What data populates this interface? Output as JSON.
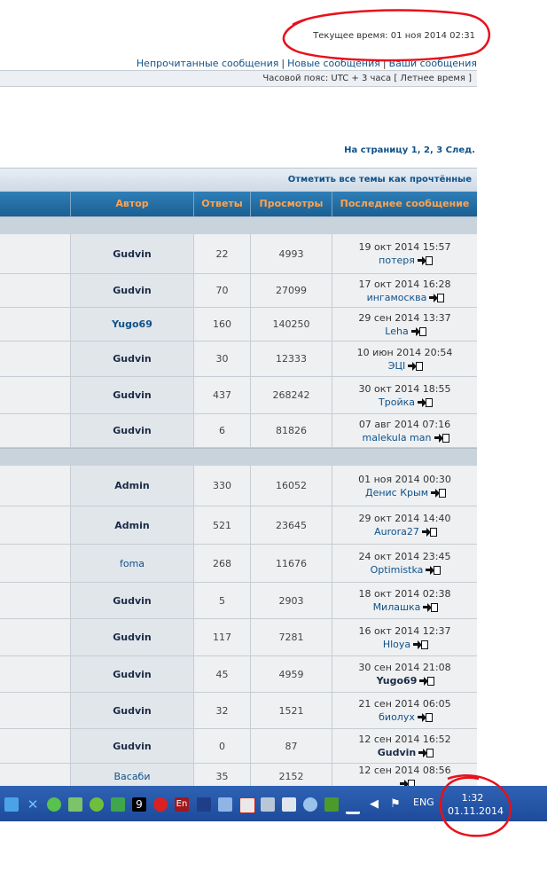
{
  "header": {
    "current_time": "Текущее время: 01 ноя 2014 02:31",
    "links": [
      "Непрочитанные сообщения",
      "Новые сообщения",
      "Ваши сообщения"
    ],
    "separator": "|",
    "timezone": "Часовой пояс: UTC + 3 часа [ Летнее время ]"
  },
  "pagination": {
    "label": "На страницу",
    "pages": [
      "1",
      "2",
      "3"
    ],
    "next": "След."
  },
  "forum": {
    "mark_all_read": "Отметить все темы как прочтённые",
    "columns": [
      "Автор",
      "Ответы",
      "Просмотры",
      "Последнее сообщение"
    ],
    "rows_group1": [
      {
        "author": "Gudvin",
        "replies": "22",
        "views": "4993",
        "last_date": "19 окт 2014 15:57",
        "last_user": "потеря"
      },
      {
        "author": "Gudvin",
        "replies": "70",
        "views": "27099",
        "last_date": "17 окт 2014 16:28",
        "last_user": "ингамосква"
      },
      {
        "author": "Yugo69",
        "replies": "160",
        "views": "140250",
        "last_date": "29 сен 2014 13:37",
        "last_user": "Leha"
      },
      {
        "author": "Gudvin",
        "replies": "30",
        "views": "12333",
        "last_date": "10 июн 2014 20:54",
        "last_user": "ЭЦI"
      },
      {
        "author": "Gudvin",
        "replies": "437",
        "views": "268242",
        "last_date": "30 окт 2014 18:55",
        "last_user": "Тройка"
      },
      {
        "author": "Gudvin",
        "replies": "6",
        "views": "81826",
        "last_date": "07 авг 2014 07:16",
        "last_user": "malekula man"
      }
    ],
    "rows_group2": [
      {
        "author": "Admin",
        "replies": "330",
        "views": "16052",
        "last_date": "01 ноя 2014 00:30",
        "last_user": "Денис Крым"
      },
      {
        "author": "Admin",
        "replies": "521",
        "views": "23645",
        "last_date": "29 окт 2014 14:40",
        "last_user": "Aurora27"
      },
      {
        "author": "foma",
        "replies": "268",
        "views": "11676",
        "last_date": "24 окт 2014 23:45",
        "last_user": "Optimistka"
      },
      {
        "author": "Gudvin",
        "replies": "5",
        "views": "2903",
        "last_date": "18 окт 2014 02:38",
        "last_user": "Милашка"
      },
      {
        "author": "Gudvin",
        "replies": "117",
        "views": "7281",
        "last_date": "16 окт 2014 12:37",
        "last_user": "Hloya"
      },
      {
        "author": "Gudvin",
        "replies": "45",
        "views": "4959",
        "last_date": "30 сен 2014 21:08",
        "last_user": "Yugo69"
      },
      {
        "author": "Gudvin",
        "replies": "32",
        "views": "1521",
        "last_date": "21 сен 2014 06:05",
        "last_user": "биолух"
      },
      {
        "author": "Gudvin",
        "replies": "0",
        "views": "87",
        "last_date": "12 сен 2014 16:52",
        "last_user": "Gudvin"
      },
      {
        "author": "Васаби",
        "replies": "35",
        "views": "2152",
        "last_date": "12 сен 2014 08:56",
        "last_user": ""
      }
    ]
  },
  "taskbar": {
    "language": "ENG",
    "clock_time": "1:32",
    "clock_date": "01.11.2014",
    "tray_nine": "9",
    "tray_en": "En",
    "icons": [
      "bluetooth-icon",
      "x-app-icon",
      "shield-icon",
      "recycle-icon",
      "utorrent-icon",
      "nine-icon",
      "clock-icon",
      "language-en-icon",
      "bluetooth-tray-icon",
      "display-icon",
      "media-icon",
      "device-icon",
      "usb-icon",
      "network-icon",
      "nvidia-icon",
      "signal-icon",
      "volume-icon",
      "flag-icon"
    ]
  },
  "colors": {
    "link": "#105289",
    "column_header_text": "#ffa34f",
    "column_header_bg": "#1a5f93",
    "taskbar": "#1d4b9a",
    "annotation": "#e8101a"
  }
}
